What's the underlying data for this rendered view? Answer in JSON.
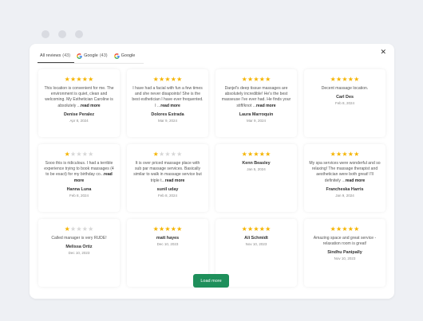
{
  "tabs": [
    {
      "label": "All reviews",
      "count": "(43)"
    },
    {
      "label": "Google",
      "count": "(43)"
    },
    {
      "label": "Google",
      "count": ""
    }
  ],
  "colors": {
    "star": "#f5b400",
    "star_empty": "#d6d6d6",
    "button": "#1e8f5b"
  },
  "reviews": [
    {
      "rating": 5,
      "text": "This location is convenient for me. The environment is quiet, clean and welcoming. My Esthetician Caroline is absolutely ...",
      "more": "read more",
      "author": "Denise Peralez",
      "date": "Apr 8, 2024"
    },
    {
      "rating": 5,
      "text": "I have had a facial with fun a few times and she never disapoints! She is the best esthetician I have ever frequented. I ...",
      "more": "read more",
      "author": "Dolores Estrada",
      "date": "Mar 9, 2024"
    },
    {
      "rating": 5,
      "text": "Danjel's deep tissue massages are absolutely incredible! He's the best masseuse I've ever had. He finds your stiff/knot ...",
      "more": "read more",
      "author": "Laura Marroquin",
      "date": "Mar 9, 2024"
    },
    {
      "rating": 5,
      "text": "Decent massage location.",
      "more": "",
      "author": "Carl Des",
      "date": "Feb 8, 2024"
    },
    {
      "rating": 1,
      "text": "Sooo this is ridiculous. I had a terrible experience trying to book massages (4 to be exact) for my birthday co...",
      "more": "read more",
      "author": "Hanna Luna",
      "date": "Feb 8, 2024"
    },
    {
      "rating": 1,
      "text": "It is over priced massage place with sub par massage services. Basically similar to walk in massage service but triple t...",
      "more": "read more",
      "author": "sunil uday",
      "date": "Feb 8, 2024"
    },
    {
      "rating": 5,
      "text": "",
      "more": "",
      "author": "Kenn Beasley",
      "date": "Jan 5, 2024"
    },
    {
      "rating": 5,
      "text": "My spa services were wonderful and so relaxing! The massage therapist and aesthetician were both great! I'll definitely ...",
      "more": "read more",
      "author": "Francheska Harris",
      "date": "Jan 9, 2024"
    },
    {
      "rating": 1,
      "text": "Called manager is very RUDE!",
      "more": "",
      "author": "Melissa Ortiz",
      "date": "Dec 10, 2023"
    },
    {
      "rating": 5,
      "text": "",
      "more": "",
      "author": "matt hayes",
      "date": "Dec 10, 2023"
    },
    {
      "rating": 5,
      "text": "",
      "more": "",
      "author": "Ali Schmidt",
      "date": "Nov 10, 2023"
    },
    {
      "rating": 5,
      "text": "Amazing space and great service - relaxation room is great!",
      "more": "",
      "author": "Sindhu Panipally",
      "date": "Nov 10, 2023"
    }
  ],
  "load_more_label": "Load more"
}
